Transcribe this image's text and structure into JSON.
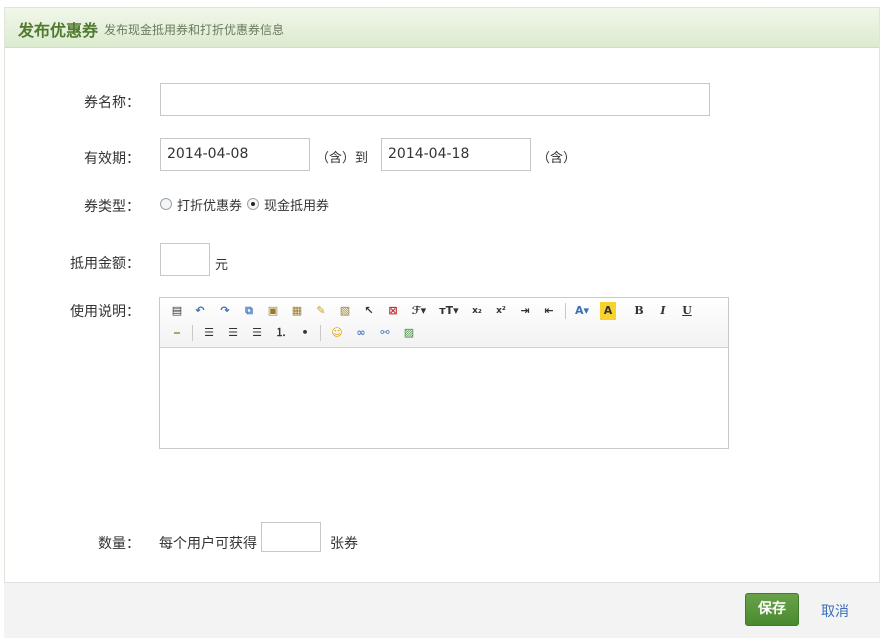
{
  "header": {
    "title": "发布优惠券",
    "subtitle": "发布现金抵用券和打折优惠券信息"
  },
  "form": {
    "name": {
      "label": "券名称：",
      "value": ""
    },
    "validity": {
      "label": "有效期：",
      "start": "2014-04-08",
      "inclusive_start": "（含）到",
      "end": "2014-04-18",
      "inclusive_end": "（含）"
    },
    "type": {
      "label": "券类型：",
      "options": [
        "打折优惠券",
        "现金抵用券"
      ],
      "selected": "现金抵用券"
    },
    "amount": {
      "label": "抵用金额：",
      "value": "",
      "unit": "元"
    },
    "description": {
      "label": "使用说明：",
      "content": ""
    },
    "quantity": {
      "label": "数量：",
      "prefix": "每个用户可获得",
      "value": "",
      "suffix": "张券"
    }
  },
  "toolbar": {
    "row1": [
      "source",
      "undo",
      "redo",
      "copy",
      "paste",
      "paste-text",
      "clean",
      "select-all",
      "pointer",
      "fullscreen",
      "font-family",
      "font-size",
      "subscript",
      "superscript",
      "indent",
      "outdent",
      "font-color",
      "highlight",
      "bold",
      "italic",
      "underline"
    ],
    "row2": [
      "horizontal-rule",
      "align-left",
      "align-center",
      "align-right",
      "ordered-list",
      "unordered-list",
      "emoticon",
      "link",
      "unlink",
      "image"
    ]
  },
  "footer": {
    "save": "保存",
    "cancel": "取消"
  },
  "colors": {
    "accent": "#4f8a2f",
    "link": "#3b6fb6",
    "header_bg": "#e4f0da"
  }
}
